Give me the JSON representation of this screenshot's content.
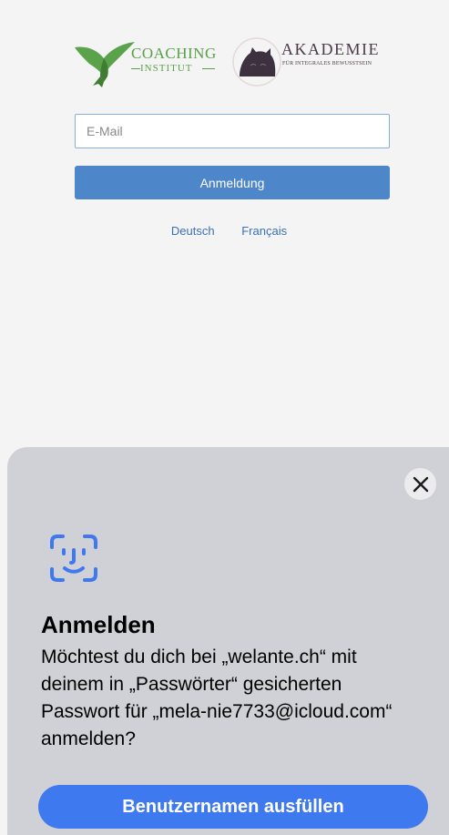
{
  "logos": {
    "coaching_word": "COACHING",
    "institut_word": "INSTITUT",
    "akademie_word": "AKADEMIE",
    "akademie_sub": "FÜR INTEGRALES BEWUSSTSEIN",
    "brand_green": "#59a049",
    "brand_plum": "#4a3a48"
  },
  "login_form": {
    "email_placeholder": "E-Mail",
    "email_value": "",
    "submit_label": "Anmeldung",
    "button_color": "#4d86c9"
  },
  "languages": [
    {
      "label": "Deutsch"
    },
    {
      "label": "Français"
    }
  ],
  "sheet": {
    "close_icon": "close-icon",
    "face_icon": "face-id-icon",
    "title": "Anmelden",
    "message": "Möchtest du dich bei „welante.ch“ mit deinem in „Passwörter“ gesicherten Passwort für „mela-nie7733@icloud.com“ anmelden?",
    "fill_button_label": "Benutzernamen ausfüllen",
    "accent_color": "#3f79f0"
  }
}
